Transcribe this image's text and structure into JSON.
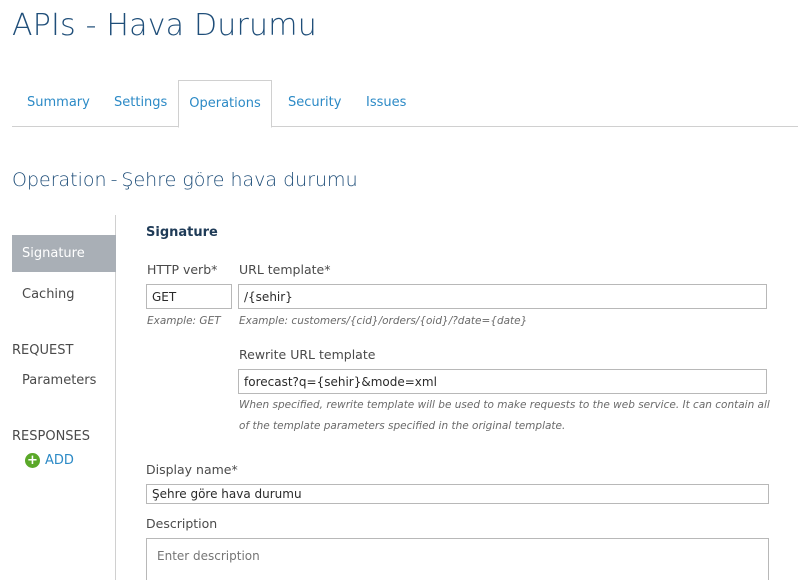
{
  "header": {
    "title": "APIs - Hava Durumu"
  },
  "tabs": [
    {
      "label": "Summary"
    },
    {
      "label": "Settings"
    },
    {
      "label": "Operations",
      "active": true
    },
    {
      "label": "Security"
    },
    {
      "label": "Issues"
    }
  ],
  "operation": {
    "prefix": "Operation",
    "separator": "-",
    "name": "Şehre göre hava durumu"
  },
  "sidebar": {
    "signature": "Signature",
    "caching": "Caching",
    "request_header": "REQUEST",
    "parameters": "Parameters",
    "responses_header": "RESPONSES",
    "add_label": "ADD",
    "add_icon": "plus-circle-icon"
  },
  "signature": {
    "title": "Signature",
    "http_verb_label": "HTTP verb*",
    "http_verb_value": "GET",
    "http_verb_hint": "Example: GET",
    "url_template_label": "URL template*",
    "url_template_value": "/{sehir}",
    "url_template_hint": "Example: customers/{cid}/orders/{oid}/?date={date}",
    "rewrite_label": "Rewrite URL template",
    "rewrite_value": "forecast?q={sehir}&mode=xml",
    "rewrite_hint": "When specified, rewrite template will be used to make requests to the web service. It can contain all of the template parameters specified in the original template.",
    "display_name_label": "Display name*",
    "display_name_value": "Şehre göre hava durumu",
    "description_label": "Description",
    "description_placeholder": "Enter description"
  },
  "colors": {
    "title": "#1f4e79",
    "link": "#2c8ac6",
    "nav_active_bg": "#a9afb6",
    "add_green": "#5aa829"
  }
}
